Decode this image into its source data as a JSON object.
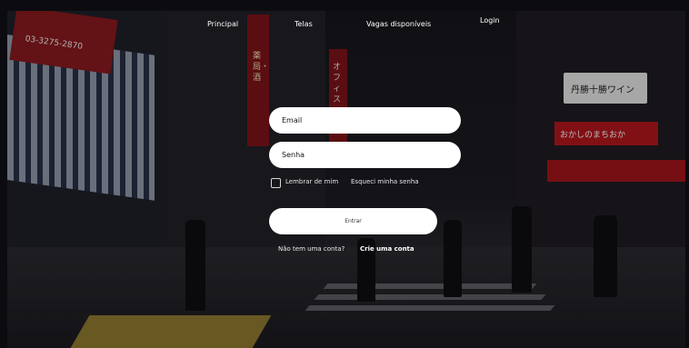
{
  "nav": {
    "principal": "Principal",
    "telas": "Telas",
    "vagas": "Vagas disponíveis",
    "login": "Login"
  },
  "form": {
    "email_placeholder": "Email",
    "senha_placeholder": "Senha",
    "remember_label": "Lembrar de mim",
    "forgot_label": "Esqueci minha senha",
    "submit_label": "Entrar",
    "no_account_text": "Não tem uma conta?",
    "create_account_label": "Crie uma conta"
  },
  "background": {
    "signs": {
      "phone": "03-3275-2870",
      "wine": "丹勝十勝ワイン",
      "okashi": "おかしのまちおか",
      "vertical_left": "薬局・酒",
      "vertical_right": "オフィス"
    },
    "colors": {
      "sign_red": "#7e1419",
      "awning_red": "#a3161d",
      "accent_yellow": "#b79a35"
    }
  }
}
